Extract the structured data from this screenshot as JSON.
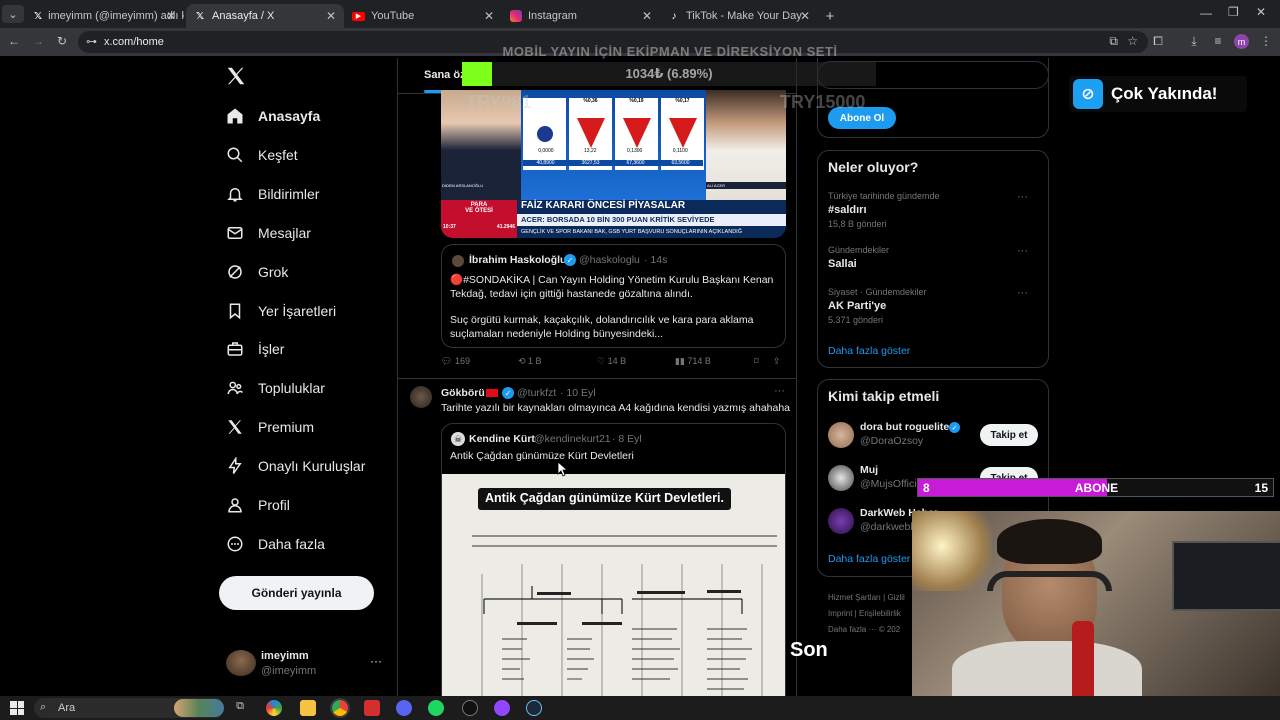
{
  "browser": {
    "tabs": [
      {
        "title": "imeyimm (@imeyimm) adlı kişi",
        "icon": "x-logo-icon"
      },
      {
        "title": "Anasayfa / X",
        "icon": "x-logo-icon"
      },
      {
        "title": "YouTube",
        "icon": "youtube-icon"
      },
      {
        "title": "Instagram",
        "icon": "instagram-icon"
      },
      {
        "title": "TikTok - Make Your Day",
        "icon": "tiktok-icon"
      }
    ],
    "new_tab": "+",
    "url": "x.com/home",
    "profile_initial": "m"
  },
  "nav": {
    "items": [
      {
        "label": "Anasayfa",
        "icon": "home-icon"
      },
      {
        "label": "Keşfet",
        "icon": "search-icon"
      },
      {
        "label": "Bildirimler",
        "icon": "bell-icon"
      },
      {
        "label": "Mesajlar",
        "icon": "mail-icon"
      },
      {
        "label": "Grok",
        "icon": "grok-icon"
      },
      {
        "label": "Yer İşaretleri",
        "icon": "bookmark-icon"
      },
      {
        "label": "İşler",
        "icon": "briefcase-icon"
      },
      {
        "label": "Topluluklar",
        "icon": "people-icon"
      },
      {
        "label": "Premium",
        "icon": "x-logo-icon"
      },
      {
        "label": "Onaylı Kuruluşlar",
        "icon": "lightning-icon"
      },
      {
        "label": "Profil",
        "icon": "person-icon"
      },
      {
        "label": "Daha fazla",
        "icon": "more-circle-icon"
      }
    ],
    "post_button": "Gönderi yayınla",
    "account": {
      "name": "imeyimm",
      "handle": "@imeyimm"
    }
  },
  "feed": {
    "tab_label": "Sana öz",
    "tv": {
      "tickers": [
        "%0,36",
        "%0,19",
        "%0,17"
      ],
      "values": [
        "0,0000",
        "13,22",
        "0,1300",
        "0,1100",
        "40,8900",
        "3627,53",
        "67,3600",
        "63,5600"
      ],
      "headline": "FAİZ KARARI ÖNCESİ PİYASALAR",
      "subheadline": "ACER: BORSADA 10 BİN 300 PUAN KRİTİK SEVİYEDE",
      "ticker_line": "GENÇLİK VE SPOR BAKANI BAK, GSB YURT BAŞVURU SONUÇLARININ AÇIKLANDIĞ",
      "badge_top": "PARA",
      "badge_bottom": "VE ÖTESİ",
      "index": "41.2946",
      "clock": "10:37",
      "left_caption": "DİDEM ARSLANOĞLU",
      "right_caption": "ALİ ACER"
    },
    "quote1": {
      "name": "İbrahim Haskoloğlu",
      "handle": "@haskologlu",
      "time": "· 14s",
      "text1": "🔴#SONDAKİKA | Can Yayın Holding Yönetim Kurulu Başkanı Kenan Tekdağ, tedavi için gittiği hastanede gözaltına alındı.",
      "text2": "Suç örgütü kurmak, kaçakçılık, dolandırıcılık ve kara para aklama suçlamaları nedeniyle Holding bünyesindeki..."
    },
    "actions1": {
      "replies": "169",
      "reposts": "1 B",
      "likes": "14 B",
      "views": "714 B"
    },
    "post2": {
      "name": "Gökbörü",
      "handle": "@turkfzt",
      "time": "· 10 Eyl",
      "text": "Tarihte yazılı bir kaynakları olmayınca A4 kağıdına kendisi yazmış ahahaha"
    },
    "quote2": {
      "name": "Kendine Kürt",
      "handle": "@kendinekurt21",
      "time": "· 8 Eyl",
      "text": "Antik Çağdan günümüze Kürt Devletleri",
      "image_title": "Antik Çağdan günümüze Kürt Devletleri."
    }
  },
  "right": {
    "subscribe_button": "Abone Ol",
    "trends_title": "Neler oluyor?",
    "trends": [
      {
        "meta": "Türkiye tarihinde gündemde",
        "name": "#saldırı",
        "count": "15,8 B gönderi"
      },
      {
        "meta": "Gündemdekiler",
        "name": "Sallai",
        "count": ""
      },
      {
        "meta": "Siyaset · Gündemdekiler",
        "name": "AK Parti'ye",
        "count": "5.371 gönderi"
      }
    ],
    "trends_more": "Daha fazla göster",
    "follow_title": "Kimi takip etmeli",
    "suggestions": [
      {
        "name": "dora but roguelite",
        "handle": "@DoraOzsoy",
        "button": "Takip et"
      },
      {
        "name": "Muj",
        "handle": "@MujsOffici",
        "button": "Takip et"
      },
      {
        "name": "DarkWeb Haber",
        "handle": "@darkwebh",
        "button": ""
      }
    ],
    "follow_more": "Daha fazla göster",
    "footer": [
      "Hizmet Şartları",
      "Gizlil",
      "Imprint",
      "Erişilebilirlik",
      "Daha fazla ···",
      "© 202"
    ]
  },
  "overlays": {
    "top_banner": "MOBİL YAYIN İÇİN EKİPMAN VE DİREKSİYON SETİ",
    "donation_amount": "1034₺ (6.89%)",
    "ghost_left": "TRY981",
    "ghost_right": "TRY15000",
    "soon_badge": "Çok Yakında!",
    "abone_left": "8",
    "abone_label": "ABONE",
    "abone_right": "15",
    "caption": "Son",
    "progress_fraction": 0.0689
  },
  "taskbar": {
    "search": "Ara"
  }
}
